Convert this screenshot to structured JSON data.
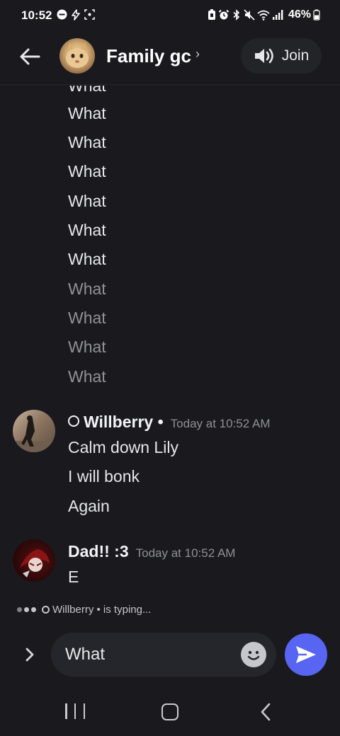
{
  "status_bar": {
    "time": "10:52",
    "battery": "46%"
  },
  "header": {
    "title": "Family gc",
    "chevron": "›",
    "join_label": "Join",
    "back_icon": "arrow-left",
    "voice_icon": "speaker"
  },
  "messages": {
    "partial_top": "What",
    "repeated": [
      {
        "text": "What",
        "dim": false
      },
      {
        "text": "What",
        "dim": false
      },
      {
        "text": "What",
        "dim": false
      },
      {
        "text": "What",
        "dim": false
      },
      {
        "text": "What",
        "dim": false
      },
      {
        "text": "What",
        "dim": false
      },
      {
        "text": "What",
        "dim": true
      },
      {
        "text": "What",
        "dim": true
      },
      {
        "text": "What",
        "dim": true
      },
      {
        "text": "What",
        "dim": true
      }
    ],
    "group1": {
      "author": "Willberry",
      "separator": "•",
      "timestamp": "Today at 10:52 AM",
      "lines": [
        "Calm down Lily",
        "I will bonk",
        "Again"
      ]
    },
    "group2": {
      "author": "Dad!! :3",
      "timestamp": "Today at 10:52 AM",
      "lines": [
        "E"
      ]
    }
  },
  "typing": {
    "user": "Willberry",
    "text": "• is typing..."
  },
  "composer": {
    "value": "What",
    "expand_icon": "chevron-right",
    "emoji_icon": "smiley",
    "send_icon": "paper-plane"
  },
  "colors": {
    "background": "#1a1a1e",
    "accent": "#5865f2",
    "text": "#e6e7ea",
    "muted": "#8e9097"
  }
}
